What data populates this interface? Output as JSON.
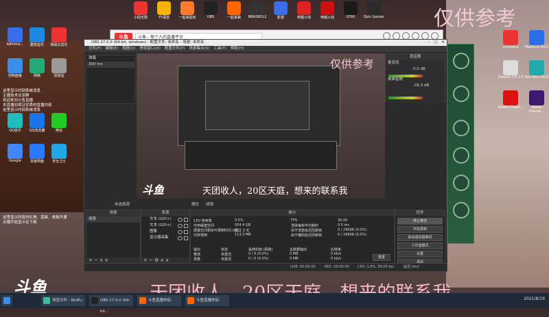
{
  "watermark": {
    "text": "仅供参考",
    "inner_text": "仅供参考"
  },
  "ticker": {
    "text": "天团收人，20区天庭，想来的联系我",
    "inner_text": "天团收人，20区天庭，想来的联系我"
  },
  "logo": {
    "text": "斗鱼"
  },
  "top_icons": [
    {
      "label": "小助无限"
    },
    {
      "label": "YY语音"
    },
    {
      "label": "一起来捉妖"
    },
    {
      "label": "OBS"
    },
    {
      "label": "一起来跳"
    },
    {
      "label": "NBA2KOL2"
    },
    {
      "label": "影游"
    },
    {
      "label": "穿越火线"
    },
    {
      "label": "穿越火线"
    },
    {
      "label": "GTA5"
    },
    {
      "label": "Epic Games"
    }
  ],
  "desktop_icons": [
    {
      "label": "Adminis..."
    },
    {
      "label": "酷狗音乐"
    },
    {
      "label": "网易云音乐"
    },
    {
      "label": "控制面板"
    },
    {
      "label": "网络"
    },
    {
      "label": "回收站"
    },
    {
      "label": "QQ音乐"
    },
    {
      "label": "QQ浏览器"
    },
    {
      "label": "微信"
    },
    {
      "label": "Google"
    },
    {
      "label": "百度网盘"
    },
    {
      "label": "安全卫士"
    }
  ],
  "desktop_notes": [
    "这里显示时刻系统消息",
    "主播技术交流群",
    "欢迎来到斗鱼直播",
    "本直播间保证优质的直播内容",
    "这里显示时刻系统消息",
    "这里显示所有的礼物、道具、贵族开通",
    "点播开始显示在下面"
  ],
  "browser": {
    "logo": "斗鱼",
    "title": "斗鱼 - 每个人的直播平台"
  },
  "obs": {
    "title": "OBS 27.0.0 (64-bit, windows) - 配置文件: 未命名 - 场景: 未命名",
    "menu": [
      "文件(F)",
      "编辑(E)",
      "视图(V)",
      "停靠窗口(D)",
      "配置文件(P)",
      "场景集合(S)",
      "工具(T)",
      "帮助(H)"
    ],
    "left_dock_items": [
      "弹幕",
      "300 ms"
    ],
    "mixer_title": "混音器",
    "mixer_tracks": [
      {
        "name": "麦克风",
        "value": "0.0 dB"
      },
      {
        "name": "桌面音频",
        "value": "-26.3 dB"
      }
    ],
    "preview_overlay": "天团收人，20区天庭，想来的联系我",
    "scene_label": "未选择源",
    "scene_buttons": [
      "属性",
      "滤镜"
    ],
    "docks": {
      "scenes": {
        "title": "场景",
        "items": [
          "场景"
        ]
      },
      "sources": {
        "title": "来源",
        "items": [
          "文本 (GDI+)",
          "文本 (GDI+)",
          "图像",
          "显示器采集"
        ]
      },
      "stats": {
        "title": "统计"
      },
      "controls": {
        "title": "控件",
        "buttons": [
          "停止推流",
          "开始录制",
          "启动虚拟摄像机",
          "工作室模式",
          "设置",
          "退出"
        ]
      }
    },
    "stats": {
      "left": [
        {
          "k": "CPU 使用率",
          "v": "0.5%"
        },
        {
          "k": "可用磁盘空间",
          "v": "504.4 GB"
        },
        {
          "k": "硬盘空间剩余可录制时间 (约)",
          "v": "超过 3 天"
        },
        {
          "k": "内存使用",
          "v": "113.3 MB"
        }
      ],
      "right": [
        {
          "k": "FPS",
          "v": "30.00"
        },
        {
          "k": "渲染每帧平均耗时",
          "v": "0.5 ms"
        },
        {
          "k": "由于渲染延迟而跳帧",
          "v": "0 / 29698 (0.0%)"
        },
        {
          "k": "由于编码延迟而跳帧",
          "v": "0 / 29698 (0.0%)"
        }
      ],
      "output_headers": [
        "输出",
        "状态",
        "丢弃的帧 (网络)",
        "总数据输出",
        "比特率"
      ],
      "outputs": [
        {
          "name": "推流",
          "status": "未激活",
          "dropped": "0 / 0 (0.0%)",
          "total": "0 MB",
          "bitrate": "0 kb/s"
        },
        {
          "name": "录像",
          "status": "未激活",
          "dropped": "0 / 0 (0.0%)",
          "total": "0 MB",
          "bitrate": "0 kb/s"
        }
      ],
      "reset": "重置"
    },
    "status": {
      "live": "LIVE: 00:00:00",
      "rec": "REC: 00:00:00",
      "cpu": "CPU: 1.0%, 30.00 fps",
      "done": "延迟 (ms)"
    }
  },
  "right_icons": [
    {
      "label": "vCamera"
    },
    {
      "label": "Mailbird 2021"
    },
    {
      "label": "Dolphin CS 2.0"
    },
    {
      "label": "3ds Max 2016"
    },
    {
      "label": "Adobe Creati..."
    },
    {
      "label": "Adobe Premie..."
    }
  ],
  "taskbar": {
    "items": [
      "浏览文件 - MuMu",
      "OBS 27.0.0 (64-bit...",
      "斗鱼直播伴侣",
      "斗鱼直播伴侣"
    ],
    "time": "2021/8/19"
  }
}
